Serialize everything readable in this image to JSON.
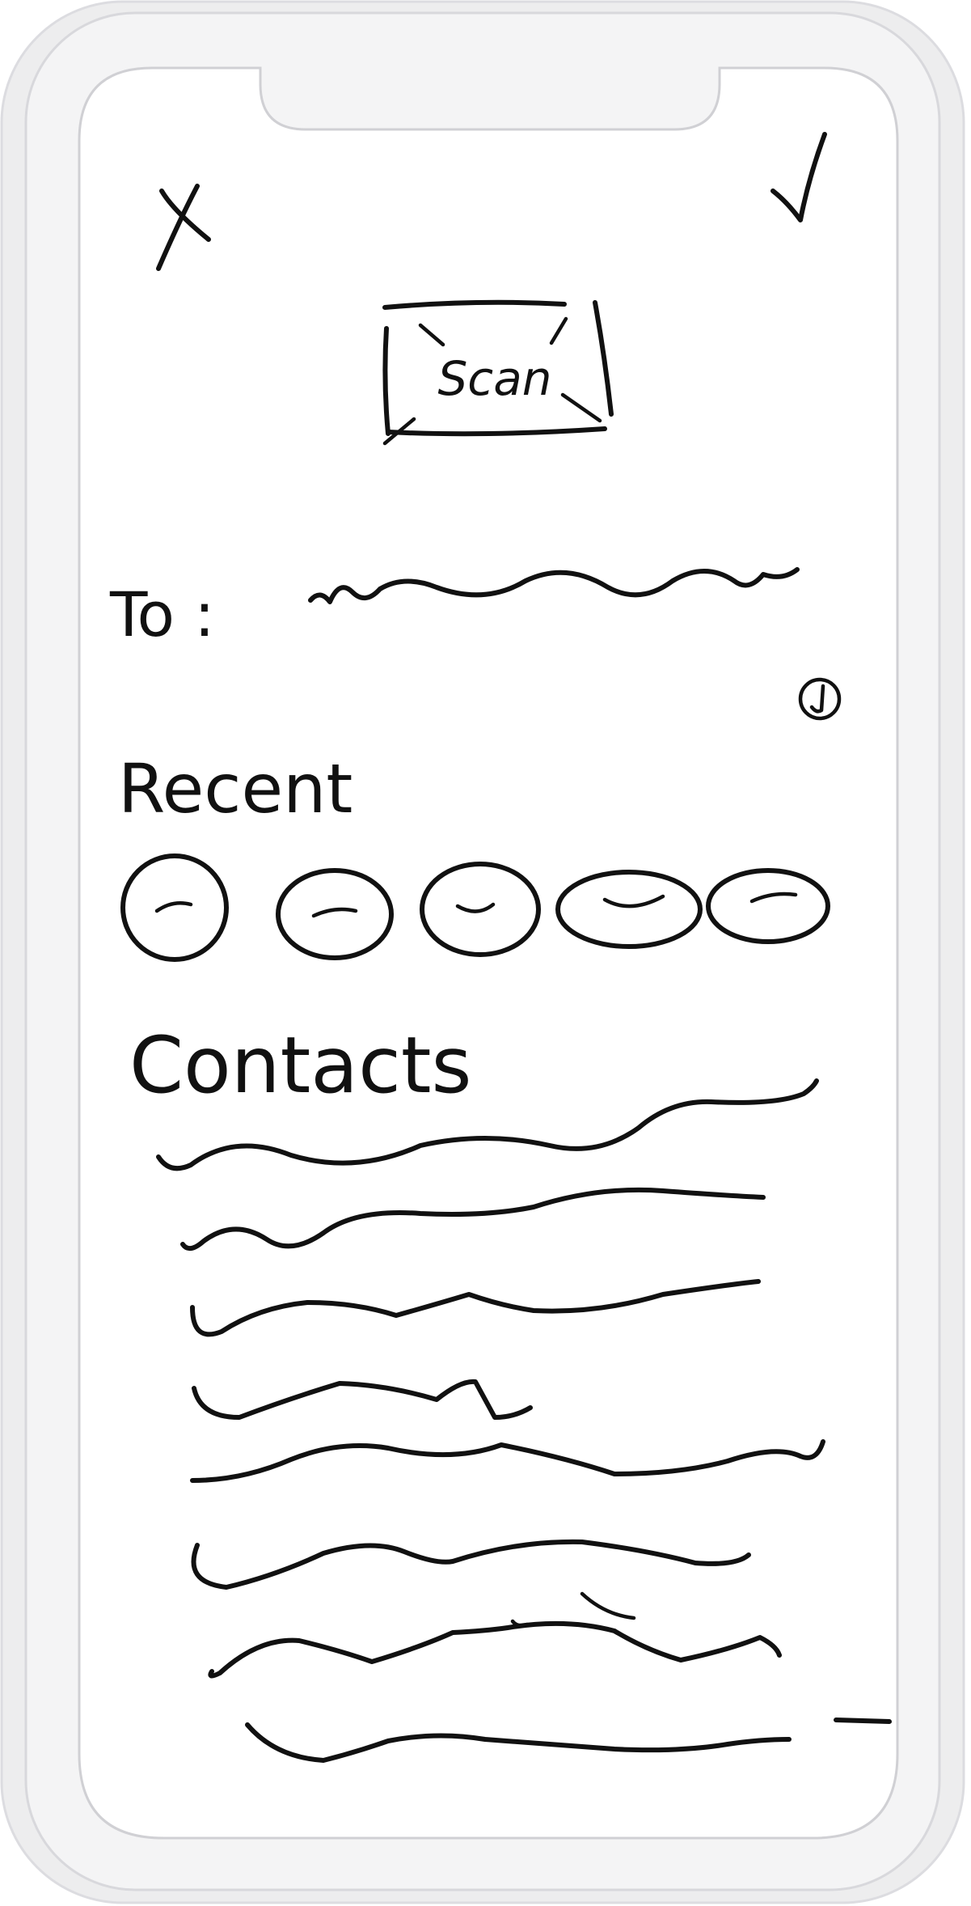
{
  "header": {
    "close_icon": "x-icon",
    "confirm_icon": "check-icon"
  },
  "scan": {
    "label": "Scan"
  },
  "to_field": {
    "label": "To :",
    "value_placeholder": "scribble-line",
    "info_icon": "info-icon"
  },
  "recent": {
    "title": "Recent",
    "avatars": [
      "avatar",
      "avatar",
      "avatar",
      "avatar",
      "avatar"
    ]
  },
  "contacts": {
    "title": "Contacts",
    "rows": [
      "scribble-line",
      "scribble-line",
      "scribble-line",
      "scribble-line",
      "scribble-line",
      "scribble-line",
      "scribble-line",
      "scribble-line"
    ]
  },
  "scroll_indicator": "dash-icon",
  "colors": {
    "ink": "#111111",
    "frame_outer": "#ececed",
    "frame_inner": "#f5f5f6",
    "screen": "#ffffff"
  }
}
